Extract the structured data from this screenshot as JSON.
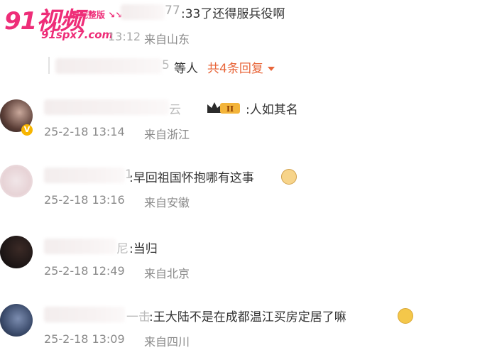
{
  "watermark": {
    "logo": "91视频",
    "tagline": "看完整版",
    "arrows": "↘↘",
    "url": "91spx7.com"
  },
  "comments": [
    {
      "name_suffix": "77",
      "text": ":33了还得服兵役啊",
      "time": "13:12",
      "location": "来自山东"
    },
    {
      "reply_suffix": "5",
      "reply_text": "等人",
      "reply_count": "共4条回复"
    },
    {
      "name_suffix": "云",
      "text": ":人如其名",
      "time": "25-2-18 13:14",
      "location": "来自浙江",
      "badge_numeral": "II"
    },
    {
      "name_suffix": "1",
      "text": ":早回祖国怀抱哪有这事",
      "time": "25-2-18 13:16",
      "location": "来自安徽"
    },
    {
      "name_suffix": "尼",
      "text": ":当归",
      "time": "25-2-18 12:49",
      "location": "来自北京"
    },
    {
      "name_suffix": "一击",
      "text": ":王大陆不是在成都温江买房定居了嘛",
      "time": "25-2-18 13:09",
      "location": "来自四川"
    }
  ],
  "colors": {
    "accent": "#e8663a",
    "meta": "#8a8a8a",
    "watermark": "#ee2d78"
  }
}
